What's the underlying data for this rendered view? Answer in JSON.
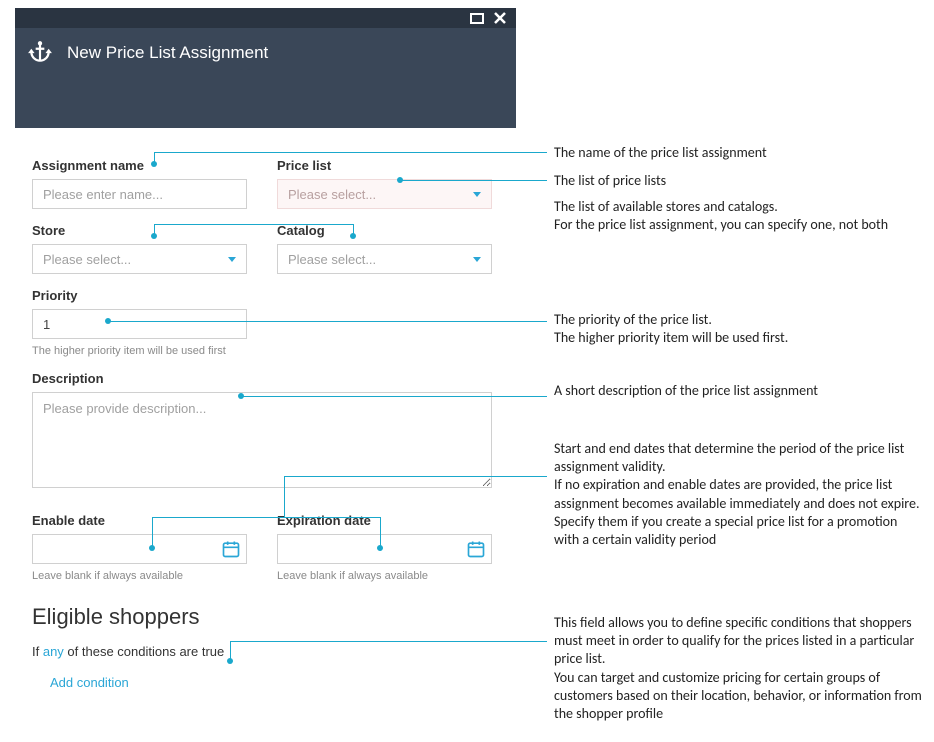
{
  "blade": {
    "title": "New Price List Assignment"
  },
  "form": {
    "assignment_name": {
      "label": "Assignment name",
      "placeholder": "Please enter name..."
    },
    "price_list": {
      "label": "Price list",
      "placeholder": "Please select..."
    },
    "store": {
      "label": "Store",
      "placeholder": "Please select..."
    },
    "catalog": {
      "label": "Catalog",
      "placeholder": "Please select..."
    },
    "priority": {
      "label": "Priority",
      "value": "1",
      "hint": "The higher priority item will be used first"
    },
    "description": {
      "label": "Description",
      "placeholder": "Please provide description..."
    },
    "enable_date": {
      "label": "Enable date",
      "hint": "Leave blank if always available"
    },
    "expiration_date": {
      "label": "Expiration date",
      "hint": "Leave blank if always available"
    }
  },
  "eligible": {
    "heading": "Eligible shoppers",
    "cond_prefix": "If ",
    "cond_any": "any",
    "cond_suffix": " of these conditions are true",
    "add_condition": "Add condition"
  },
  "annotations": {
    "name": "The name of the price list assignment",
    "pricelist": "The list of price lists",
    "store_catalog": "The list of available stores and catalogs.\nFor the price list assignment, you can specify one, not both",
    "priority": "The priority of the price list.\nThe higher priority item will be used first.",
    "description": "A short description of the price list assignment",
    "dates": "Start and end dates that determine the period of the price list assignment validity.\nIf no expiration and enable dates are provided, the price list assignment becomes available immediately and does not expire.\nSpecify them if you create a special price list for a promotion with a certain validity period",
    "eligible": "This field allows you to define specific conditions that shoppers must meet in order to qualify for the prices listed in a particular price list.\nYou can target and customize pricing for certain groups of customers based on their location, behavior, or information from the shopper profile"
  }
}
